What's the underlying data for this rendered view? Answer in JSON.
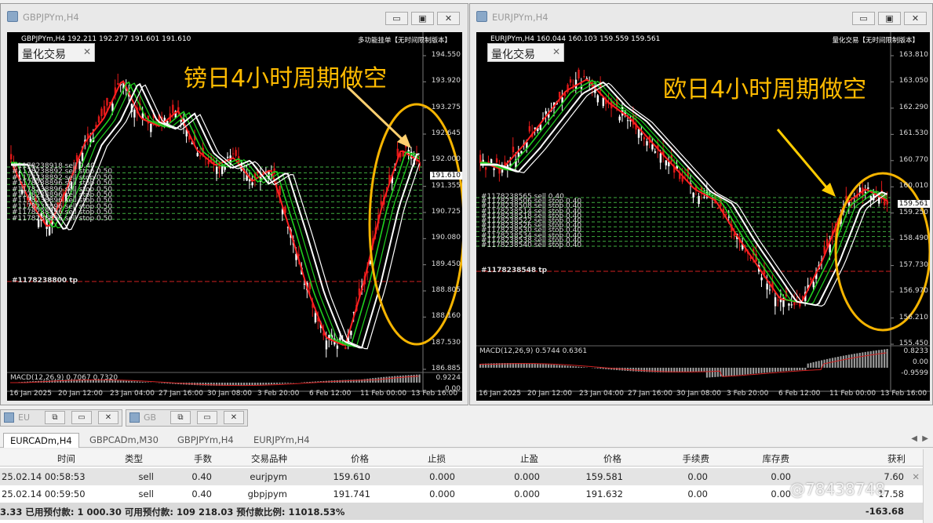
{
  "windows": [
    {
      "id": "left",
      "title": "GBPJPYm,H4",
      "header": "GBPJPYm,H4  192.211 192.277 191.601 191.610",
      "header_right": "多功能挂单【无时间限制版本】",
      "panel_label": "量化交易",
      "annotation": "镑日4小时周期做空",
      "price_labels": [
        "194.550",
        "193.920",
        "193.275",
        "192.645",
        "192.000",
        "191.355",
        "190.725",
        "190.080",
        "189.450",
        "188.805",
        "188.160",
        "187.530",
        "186.885"
      ],
      "current_price": "191.610",
      "tp_label": "#1178238800 tp",
      "order_labels": [
        "#1178238918 sell 0.40",
        "#1178238892 sell stop 0.50",
        "#1178238892 sell stop 0.50",
        "#1178238896 sell stop 0.50",
        "#1178238896 sell stop 0.50",
        "#1178238896 sell stop 0.50",
        "#1178238896 sell stop 0.50",
        "#1178238896 sell stop 0.50",
        "#1178238896 sell stop 0.50",
        "#1178238896 sell stop 0.50"
      ],
      "macd_label": "MACD(12,26,9) 0.7067 0.7320",
      "macd_values": [
        "0.9224",
        "0.00"
      ],
      "x_labels": [
        "16 Jan 2025",
        "20 Jan 12:00",
        "23 Jan 04:00",
        "27 Jan 16:00",
        "30 Jan 08:00",
        "3 Feb 20:00",
        "6 Feb 12:00",
        "11 Feb 00:00",
        "13 Feb 16:00"
      ]
    },
    {
      "id": "right",
      "title": "EURJPYm,H4",
      "header": "EURJPYm,H4  160.044 160.103 159.559 159.561",
      "header_right": "量化交易【无时间限制版本】",
      "panel_label": "量化交易",
      "annotation": "欧日4小时周期做空",
      "price_labels": [
        "163.810",
        "163.050",
        "162.290",
        "161.530",
        "160.770",
        "160.010",
        "159.250",
        "158.490",
        "157.730",
        "156.970",
        "156.210",
        "155.450"
      ],
      "current_price": "159.561",
      "tp_label": "#1178238548 tp",
      "order_labels": [
        "#1178238565 sell 0.40",
        "#1178238506 sell stop 0.40",
        "#1178238508 sell stop 0.40",
        "#1178238514 sell stop 0.40",
        "#1178238518 sell stop 0.40",
        "#1178238522 sell stop 0.40",
        "#1178238526 sell stop 0.40",
        "#1178238530 sell stop 0.40",
        "#1178238534 sell stop 0.40",
        "#1178238538 sell stop 0.40",
        "#1178238540 sell stop 0.40"
      ],
      "macd_label": "MACD(12,26,9) 0.5744 0.6361",
      "macd_values": [
        "0.8233",
        "0.00",
        "-0.9599"
      ],
      "x_labels": [
        "16 Jan 2025",
        "20 Jan 12:00",
        "23 Jan 04:00",
        "27 Jan 16:00",
        "30 Jan 08:00",
        "3 Feb 20:00",
        "6 Feb 12:00",
        "11 Feb 00:00",
        "13 Feb 16:00"
      ]
    }
  ],
  "minimized": [
    {
      "title": "EU"
    },
    {
      "title": "GB"
    }
  ],
  "tabs": [
    "EURCADm,H4",
    "GBPCADm,M30",
    "GBPJPYm,H4",
    "EURJPYm,H4"
  ],
  "table": {
    "headers": [
      "时间",
      "类型",
      "手数",
      "交易品种",
      "价格",
      "止损",
      "止盈",
      "价格",
      "手续费",
      "库存费",
      "获利"
    ],
    "rows": [
      [
        "25.02.14 00:58:53",
        "sell",
        "0.40",
        "eurjpym",
        "159.610",
        "0.000",
        "0.000",
        "159.581",
        "0.00",
        "0.00",
        "7.60"
      ],
      [
        "25.02.14 00:59:50",
        "sell",
        "0.40",
        "gbpjpym",
        "191.741",
        "0.000",
        "0.000",
        "191.632",
        "0.00",
        "0.00",
        "17.58"
      ]
    ],
    "summary": "3.33  已用预付款: 1 000.30  可用预付款: 109 218.03  预付款比例: 11018.53%",
    "summary_profit": "-163.68"
  },
  "watermark": "@78438748",
  "colors": {
    "chart_bg": "#000000",
    "annotation": "#ffbb00",
    "circle": "#f5b400",
    "ma_red": "#ff2020",
    "ma_green": "#1fd01f",
    "ma_white": "#ffffff",
    "level_green": "#3fae3f",
    "tp_red": "#d02020"
  }
}
